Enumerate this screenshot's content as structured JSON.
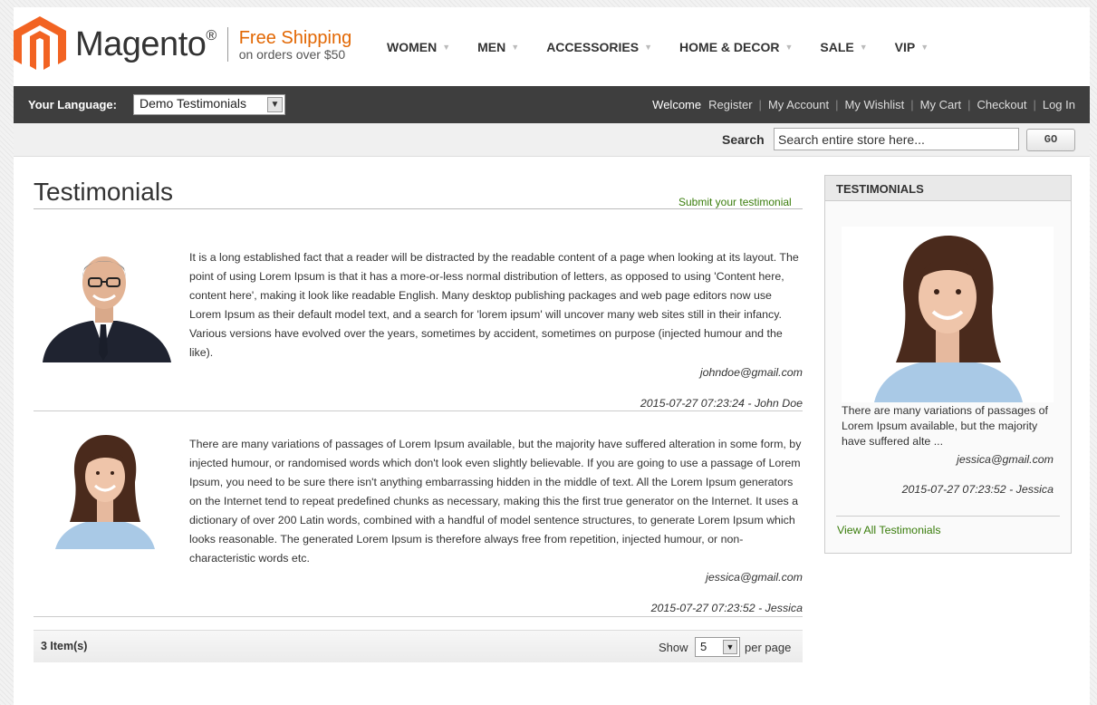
{
  "brand": {
    "name": "Magento",
    "trademark": "®",
    "promo_line1": "Free Shipping",
    "promo_line2": "on orders over $50",
    "accent": "#e26703",
    "logo_color": "#f26322"
  },
  "nav": {
    "items": [
      {
        "label": "WOMEN"
      },
      {
        "label": "MEN"
      },
      {
        "label": "ACCESSORIES"
      },
      {
        "label": "HOME & DECOR"
      },
      {
        "label": "SALE"
      },
      {
        "label": "VIP"
      }
    ]
  },
  "topbar": {
    "language_label": "Your Language:",
    "language_value": "Demo Testimonials",
    "welcome": "Welcome",
    "links": [
      "Register",
      "My Account",
      "My Wishlist",
      "My Cart",
      "Checkout",
      "Log In"
    ]
  },
  "search": {
    "label": "Search",
    "placeholder": "Search entire store here...",
    "button": "GO"
  },
  "main": {
    "title": "Testimonials",
    "submit_link": "Submit your testimonial",
    "entries": [
      {
        "text": "It is a long established fact that a reader will be distracted by the readable content of a page when looking at its layout. The point of using Lorem Ipsum is that it has a more-or-less normal distribution of letters, as opposed to using 'Content here, content here', making it look like readable English. Many desktop publishing packages and web page editors now use Lorem Ipsum as their default model text, and a search for 'lorem ipsum' will uncover many web sites still in their infancy. Various versions have evolved over the years, sometimes by accident, sometimes on purpose (injected humour and the like).",
        "email": "johndoe@gmail.com",
        "meta": "2015-07-27 07:23:24 - John Doe"
      },
      {
        "text": "There are many variations of passages of Lorem Ipsum available, but the majority have suffered alteration in some form, by injected humour, or randomised words which don't look even slightly believable. If you are going to use a passage of Lorem Ipsum, you need to be sure there isn't anything embarrassing hidden in the middle of text. All the Lorem Ipsum generators on the Internet tend to repeat predefined chunks as necessary, making this the first true generator on the Internet. It uses a dictionary of over 200 Latin words, combined with a handful of model sentence structures, to generate Lorem Ipsum which looks reasonable. The generated Lorem Ipsum is therefore always free from repetition, injected humour, or non-characteristic words etc.",
        "email": "jessica@gmail.com",
        "meta": "2015-07-27 07:23:52 - Jessica"
      }
    ],
    "toolbar": {
      "count": "3 Item(s)",
      "show_label": "Show",
      "per_page_value": "5",
      "per_page_label": "per page"
    }
  },
  "sidebar": {
    "title": "TESTIMONIALS",
    "excerpt": "There are many variations of passages of Lorem Ipsum available, but the majority have suffered alte ...",
    "email": "jessica@gmail.com",
    "meta": "2015-07-27 07:23:52 - Jessica",
    "view_all": "View All Testimonials"
  }
}
